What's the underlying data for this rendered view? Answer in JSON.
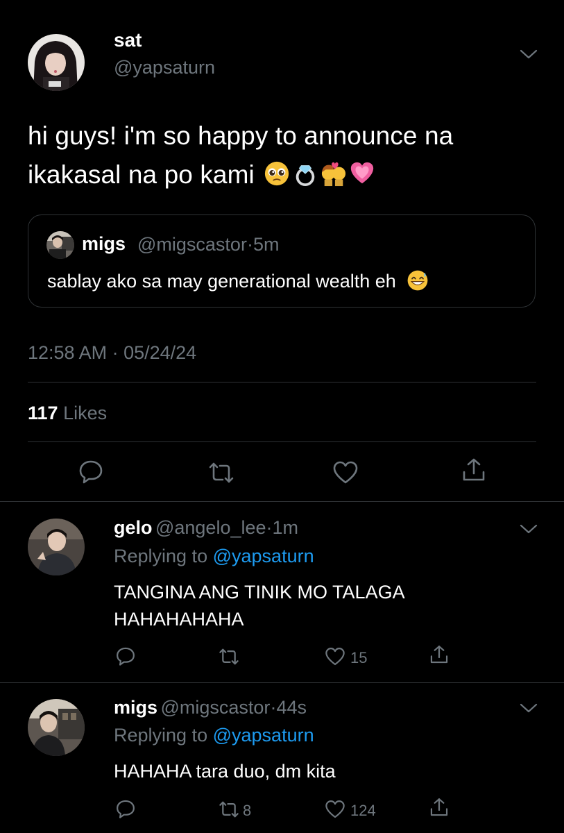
{
  "main_tweet": {
    "display_name": "sat",
    "handle": "@yapsaturn",
    "text": "hi guys! i'm so happy to announce na ikakasal na po kami",
    "emojis": [
      "pleading-face-emoji",
      "ring-emoji",
      "kiss-couple-emoji",
      "growing-heart-emoji"
    ],
    "quote": {
      "display_name": "migs",
      "handle": "@migscastor",
      "time": "5m",
      "text": "sablay ako sa may generational wealth eh",
      "emoji": "grinning-sweat-emoji"
    },
    "timestamp": "12:58 AM · 05/24/24",
    "likes_count": "117",
    "likes_label": "Likes"
  },
  "replies": [
    {
      "display_name": "gelo",
      "handle": "@angelo_lee",
      "time": "1m",
      "replying_label": "Replying to",
      "replying_to": "@yapsaturn",
      "text_line1": "TANGINA ANG TINIK MO TALAGA",
      "text_line2": "HAHAHAHAHA",
      "retweets": "",
      "likes": "15"
    },
    {
      "display_name": "migs",
      "handle": "@migscastor",
      "time": "44s",
      "replying_label": "Replying to",
      "replying_to": "@yapsaturn",
      "text_line1": "HAHAHA tara duo, dm kita",
      "retweets": "8",
      "likes": "124"
    }
  ],
  "separator": "·",
  "colors": {
    "background": "#000000",
    "text": "#ffffff",
    "muted": "#6e767d",
    "link": "#1d9bf0",
    "divider": "#2f3336"
  }
}
